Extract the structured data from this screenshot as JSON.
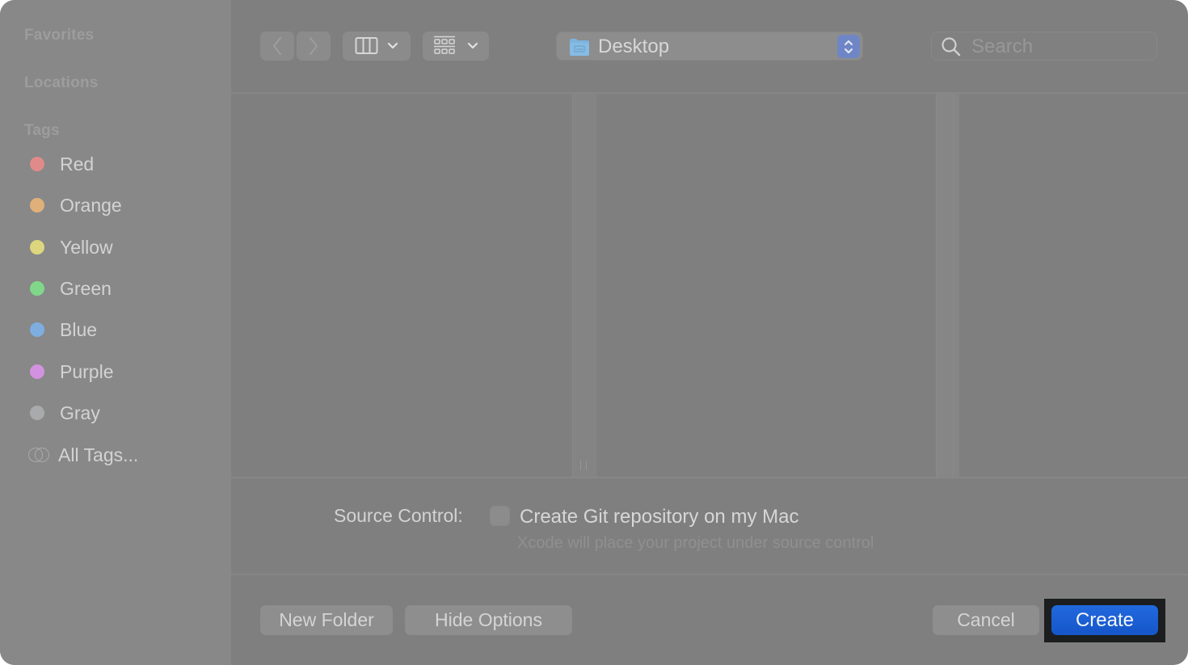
{
  "sidebar": {
    "sections": {
      "favorites": "Favorites",
      "locations": "Locations",
      "tags": "Tags"
    },
    "tags": [
      {
        "label": "Red",
        "color": "#e08a8a"
      },
      {
        "label": "Orange",
        "color": "#e0b07a"
      },
      {
        "label": "Yellow",
        "color": "#dcd67e"
      },
      {
        "label": "Green",
        "color": "#80d78a"
      },
      {
        "label": "Blue",
        "color": "#7eaee0"
      },
      {
        "label": "Purple",
        "color": "#d392e0"
      },
      {
        "label": "Gray",
        "color": "#a9aaab"
      }
    ],
    "all_tags": "All Tags..."
  },
  "toolbar": {
    "back_icon": "chevron-left-icon",
    "forward_icon": "chevron-right-icon",
    "view_mode_icon": "columns-icon",
    "group_icon": "grid-icon",
    "location": "Desktop",
    "location_icon": "desktop-folder-icon",
    "search_placeholder": "Search"
  },
  "options": {
    "source_control_label": "Source Control:",
    "git_checkbox_label": "Create Git repository on my Mac",
    "git_checkbox_checked": false,
    "git_help_text": "Xcode will place your project under source control"
  },
  "buttons": {
    "new_folder": "New Folder",
    "hide_options": "Hide Options",
    "cancel": "Cancel",
    "create": "Create"
  },
  "colors": {
    "accent": "#1a5fd6"
  }
}
